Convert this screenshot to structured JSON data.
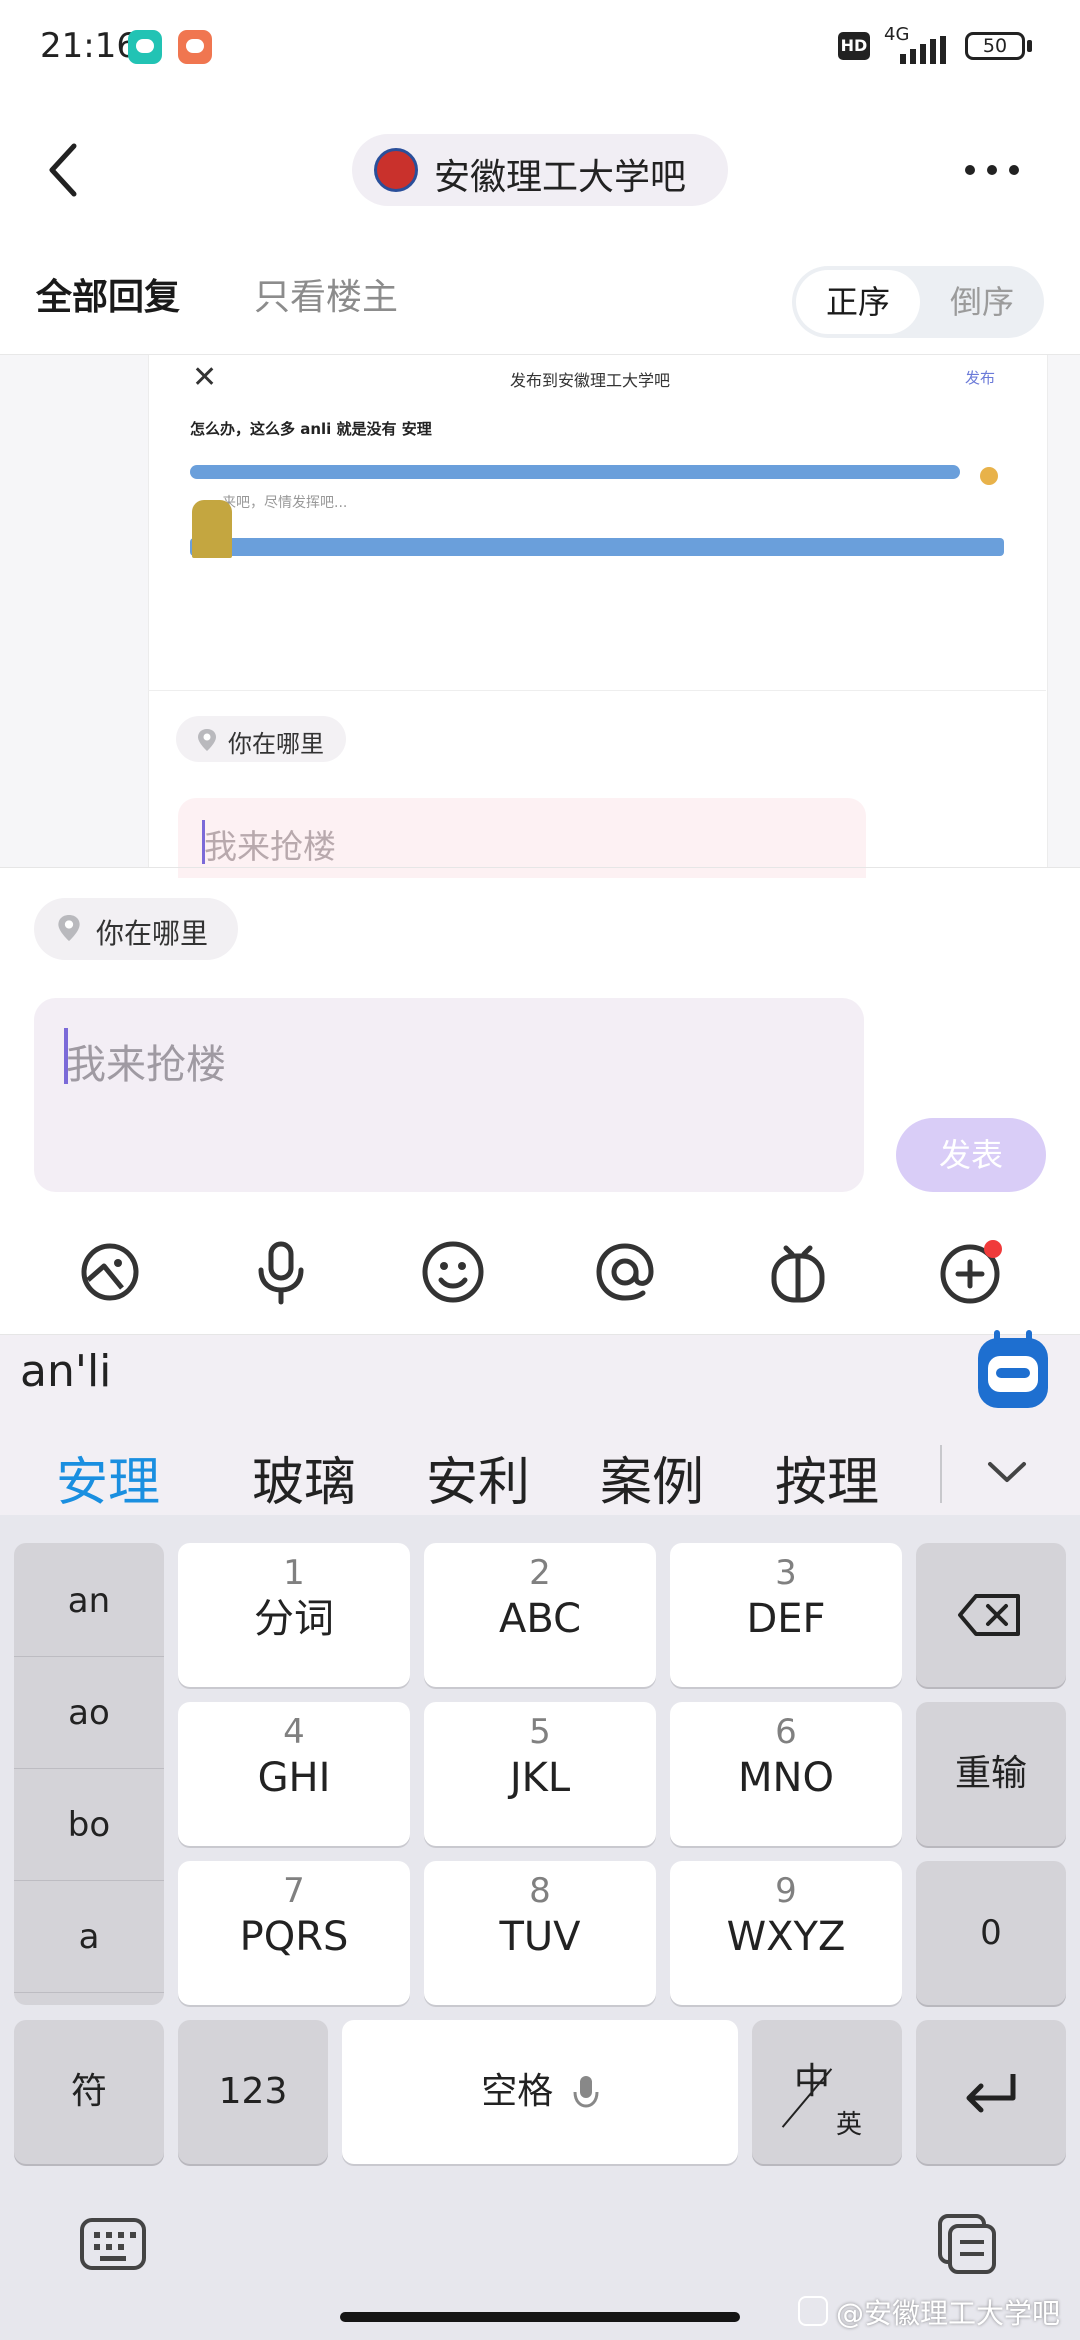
{
  "status_bar": {
    "time": "21:16",
    "hd": "HD",
    "network": "4G",
    "battery": "50"
  },
  "header": {
    "forum_name": "安徽理工大学吧"
  },
  "tabs": {
    "all_replies": "全部回复",
    "op_only": "只看楼主",
    "sort_asc": "正序",
    "sort_desc": "倒序"
  },
  "embed": {
    "title": "发布到安徽理工大学吧",
    "post": "发布",
    "text": "怎么办，这么多 anli 就是没有 安理",
    "placeholder": "来吧，尽情发挥吧...",
    "location": "你在哪里",
    "input_text": "我来抢楼"
  },
  "composer": {
    "location": "你在哪里",
    "placeholder": "我来抢楼",
    "publish": "发表"
  },
  "ime": {
    "composing": "an'li",
    "candidates": [
      "安理",
      "玻璃",
      "安利",
      "案例",
      "按理"
    ],
    "pinyin": [
      "an",
      "ao",
      "bo",
      "a"
    ],
    "keys": [
      {
        "num": "1",
        "letters": "分词"
      },
      {
        "num": "2",
        "letters": "ABC"
      },
      {
        "num": "3",
        "letters": "DEF"
      },
      {
        "num": "4",
        "letters": "GHI"
      },
      {
        "num": "5",
        "letters": "JKL"
      },
      {
        "num": "6",
        "letters": "MNO"
      },
      {
        "num": "7",
        "letters": "PQRS"
      },
      {
        "num": "8",
        "letters": "TUV"
      },
      {
        "num": "9",
        "letters": "WXYZ"
      }
    ],
    "reset": "重输",
    "zero": "0",
    "symbol": "符",
    "num_mode": "123",
    "space": "空格",
    "lang_zh": "中",
    "lang_en": "英"
  },
  "watermark": "@安徽理工大学吧",
  "colors": {
    "accent_purple": "#7b6ad8",
    "candidate_blue": "#1a8fe0",
    "publish_disabled": "#d9cdf7"
  }
}
